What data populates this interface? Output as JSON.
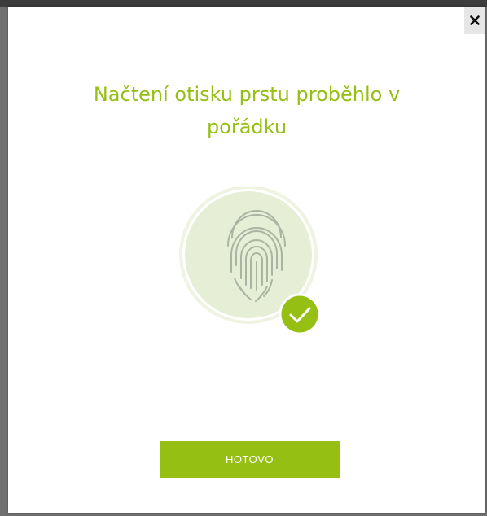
{
  "dialog": {
    "title": "Načtení otisku prstu proběhlo v pořádku",
    "close_icon": "close-icon",
    "illustration_icon": "fingerprint-icon",
    "status_icon": "checkmark-icon",
    "done_label": "HOTOVO"
  },
  "colors": {
    "accent": "#95bf12",
    "circle_fill": "#e6eed5",
    "circle_ring": "#eef3e2",
    "fingerprint": "#a9b4a3"
  }
}
